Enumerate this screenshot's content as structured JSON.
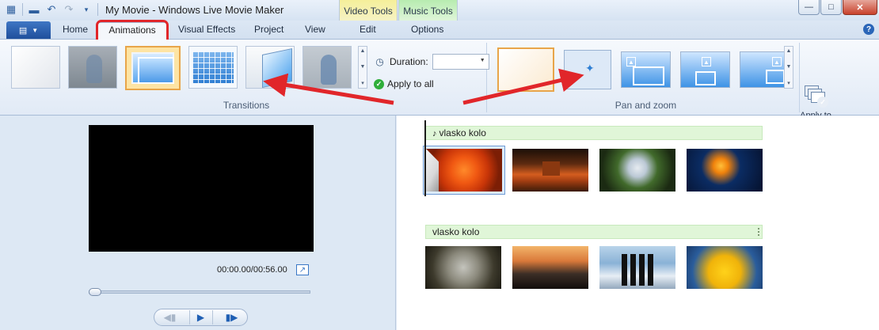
{
  "window": {
    "title": "My Movie - Windows Live Movie Maker",
    "controls": {
      "minimize": "—",
      "maximize": "□",
      "close": "✕"
    }
  },
  "context_tabs": [
    {
      "label": "Video Tools",
      "tab": "Edit",
      "color": "#f5ef9a"
    },
    {
      "label": "Music Tools",
      "tab": "Options",
      "color": "#b7ecb0"
    }
  ],
  "tabs": [
    "Home",
    "Animations",
    "Visual Effects",
    "Project",
    "View"
  ],
  "active_tab": "Animations",
  "help": "?",
  "ribbon": {
    "transitions": {
      "label": "Transitions",
      "duration_label": "Duration:",
      "duration_value": "",
      "apply_label": "Apply to all"
    },
    "panzoom": {
      "label": "Pan and zoom",
      "apply_label": "Apply to all"
    }
  },
  "preview": {
    "timecode": "00:00.00/00:56.00"
  },
  "storyboard": {
    "tracks": [
      {
        "label": "vlasko kolo"
      },
      {
        "label": "vlasko kolo"
      }
    ]
  },
  "colors": {
    "accent": "#2b66b8",
    "highlight": "#e1262a",
    "selection": "#e8a54a",
    "music_track": "#e0f6d8"
  },
  "icons": {
    "app_menu": "app-menu-icon",
    "save": "save-icon",
    "undo": "undo-icon",
    "redo": "redo-icon",
    "clock": "clock-icon",
    "check": "check-icon",
    "note": "music-note-icon"
  }
}
